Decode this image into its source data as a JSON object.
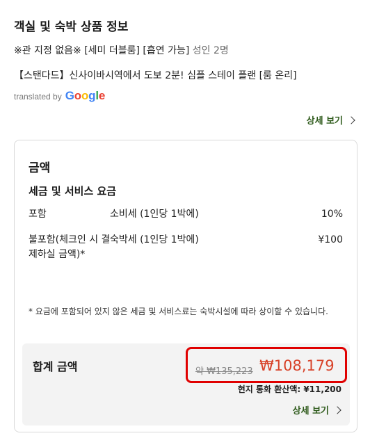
{
  "section": {
    "title": "객실 및 숙박 상품 정보"
  },
  "room": {
    "info": "※관 지정 없음※ [세미 더블룸] [흡연 가능]",
    "occupancy": "성인 2명"
  },
  "plan": {
    "name": "【스탠다드】신사이바시역에서 도보 2분! 심플 스테이 플랜 [룸 온리]"
  },
  "translation": {
    "by_text": "translated by",
    "logo_letters": [
      {
        "char": "G",
        "color": "#4285F4"
      },
      {
        "char": "o",
        "color": "#EA4335"
      },
      {
        "char": "o",
        "color": "#FBBC05"
      },
      {
        "char": "g",
        "color": "#4285F4"
      },
      {
        "char": "l",
        "color": "#34A853"
      },
      {
        "char": "e",
        "color": "#EA4335"
      }
    ]
  },
  "details_link": {
    "label": "상세 보기"
  },
  "price_card": {
    "title": "금액",
    "subtitle": "세금 및 서비스 요금",
    "fees": [
      {
        "status": "포함",
        "description": "소비세 (1인당 1박에)",
        "amount": "10%"
      },
      {
        "status": "불포함(체크인 시 결제하실 금액)*",
        "description": "숙박세 (1인당 1박에)",
        "amount": "¥100"
      }
    ],
    "note": "* 요금에 포함되어 있지 않은 세금 및 서비스료는 숙박시설에 따라 상이할 수 있습니다.",
    "total": {
      "label": "합계 금액",
      "original_price": "약 ₩135,223",
      "discounted_price": "₩108,179",
      "local_price": "현지 통화 환산액: ¥11,200",
      "details_label": "상세 보기"
    }
  },
  "colors": {
    "accent_green": "#2f5b1c",
    "price_red": "#d8432a",
    "highlight_frame": "#e00000"
  }
}
